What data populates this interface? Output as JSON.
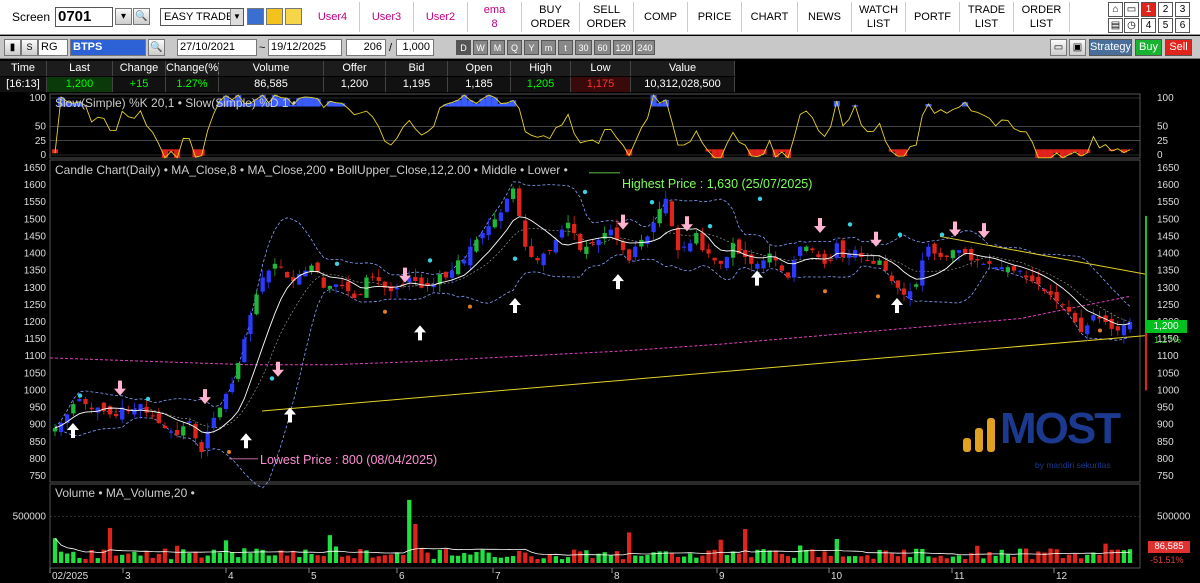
{
  "toolbar": {
    "screen_label": "Screen",
    "screen_code": "0701",
    "mode": "EASY TRADE",
    "menu": [
      {
        "label": "User4",
        "kind": "user"
      },
      {
        "label": "User3",
        "kind": "user"
      },
      {
        "label": "User2",
        "kind": "user"
      },
      {
        "label": "ema\n8",
        "kind": "user"
      },
      {
        "label": "BUY\nORDER",
        "kind": "std"
      },
      {
        "label": "SELL\nORDER",
        "kind": "std"
      },
      {
        "label": "COMP",
        "kind": "std"
      },
      {
        "label": "PRICE",
        "kind": "std"
      },
      {
        "label": "CHART",
        "kind": "std"
      },
      {
        "label": "NEWS",
        "kind": "std"
      },
      {
        "label": "WATCH\nLIST",
        "kind": "std"
      },
      {
        "label": "PORTF",
        "kind": "std"
      },
      {
        "label": "TRADE\nLIST",
        "kind": "std"
      },
      {
        "label": "ORDER\nLIST",
        "kind": "std"
      }
    ],
    "grid_top": [
      "1",
      "2",
      "3"
    ],
    "grid_bot": [
      "4",
      "5",
      "6"
    ]
  },
  "chartbar": {
    "s_label": "S",
    "market": "RG",
    "symbol": "BTPS",
    "date_from": "27/10/2021",
    "date_to": "19/12/2025",
    "count": "206",
    "span": "1,000",
    "timeframes": [
      "D",
      "W",
      "M",
      "Q",
      "Y",
      "m",
      "t",
      "30",
      "60",
      "120",
      "240"
    ],
    "strategy": "Strategy",
    "buy": "Buy",
    "sell": "Sell"
  },
  "quote": {
    "headers": [
      "Time",
      "Last",
      "Change",
      "Change(%)",
      "Volume",
      "Offer",
      "Bid",
      "Open",
      "High",
      "Low",
      "Value"
    ],
    "values": [
      "[16:13]",
      "1,200",
      "+15",
      "1.27%",
      "86,585",
      "1,200",
      "1,195",
      "1,185",
      "1,205",
      "1,175",
      "10,312,028,500"
    ],
    "colors": [
      "#ffffff",
      "#00ff00",
      "#00ff00",
      "#00ff00",
      "#ffffff",
      "#ffffff",
      "#ffffff",
      "#ffffff",
      "#00ff00",
      "#ff3030",
      "#ffffff"
    ]
  },
  "stoch": {
    "title": "Slow(Simple) %K  20,1 • Slow(Simple) %D  1 •",
    "ticks": [
      100,
      50,
      25,
      0
    ]
  },
  "candle": {
    "title": "Candle Chart(Daily) • MA_Close,8 • MA_Close,200 • BollUpper_Close,12,2.00 • Middle • Lower •",
    "highest": "Highest Price : 1,630 (25/07/2025)",
    "lowest": "Lowest Price : 800 (08/04/2025)",
    "last_tag": "1,200",
    "pct_tag": "1.27%",
    "logo": "MOST",
    "logo_sub": "by mandiri sekuritas"
  },
  "volume": {
    "title": "Volume • MA_Volume,20 •",
    "tick": "500000",
    "last_tag": "86,585",
    "pct_tag": "-51.51%"
  },
  "xaxis": {
    "labels": [
      "02/2025",
      "3",
      "4",
      "5",
      "6",
      "7",
      "8",
      "9",
      "10",
      "11",
      "12"
    ]
  },
  "chart_data": {
    "type": "candlestick",
    "title": "Candle Chart(Daily)",
    "series": [
      {
        "name": "MA_Close,8"
      },
      {
        "name": "MA_Close,200"
      },
      {
        "name": "BollUpper_Close,12,2.00"
      },
      {
        "name": "Middle"
      },
      {
        "name": "Lower"
      }
    ],
    "y_ticks": [
      1650,
      1600,
      1550,
      1500,
      1450,
      1400,
      1350,
      1300,
      1250,
      1200,
      1150,
      1100,
      1050,
      1000,
      950,
      900,
      850,
      800,
      750
    ],
    "ylim": [
      750,
      1650
    ],
    "highest": 1630,
    "lowest": 800,
    "last": 1200,
    "volume_y_ticks": [
      500000
    ],
    "stochastic_ticks": [
      0,
      25,
      50,
      100
    ],
    "x_months": [
      "02/2025",
      "3",
      "4",
      "5",
      "6",
      "7",
      "8",
      "9",
      "10",
      "11",
      "12"
    ],
    "close_path": [
      890,
      905,
      930,
      960,
      975,
      960,
      945,
      950,
      940,
      930,
      925,
      950,
      940,
      945,
      960,
      935,
      925,
      905,
      890,
      880,
      870,
      895,
      910,
      860,
      820,
      880,
      920,
      950,
      990,
      1020,
      1080,
      1150,
      1220,
      1280,
      1330,
      1350,
      1370,
      1360,
      1330,
      1320,
      1340,
      1350,
      1365,
      1345,
      1300,
      1305,
      1310,
      1305,
      1290,
      1270,
      1280,
      1330,
      1330,
      1320,
      1300,
      1290,
      1300,
      1310,
      1330,
      1320,
      1300,
      1305,
      1310,
      1340,
      1330,
      1350,
      1380,
      1380,
      1420,
      1440,
      1460,
      1480,
      1500,
      1520,
      1560,
      1590,
      1510,
      1420,
      1390,
      1380,
      1400,
      1410,
      1440,
      1470,
      1490,
      1460,
      1410,
      1420,
      1430,
      1440,
      1460,
      1470,
      1440,
      1410,
      1380,
      1420,
      1440,
      1450,
      1490,
      1530,
      1560,
      1480,
      1410,
      1420,
      1430,
      1460,
      1410,
      1400,
      1380,
      1370,
      1390,
      1430,
      1400,
      1390,
      1370,
      1370,
      1380,
      1400,
      1380,
      1350,
      1330,
      1380,
      1420,
      1420,
      1410,
      1390,
      1370,
      1380,
      1430,
      1390,
      1400,
      1410,
      1390,
      1380,
      1370,
      1380,
      1350,
      1320,
      1300,
      1280,
      1290,
      1310,
      1380,
      1420,
      1400,
      1390,
      1390,
      1410,
      1410,
      1400,
      1380,
      1380,
      1370,
      1370,
      1360,
      1360,
      1360,
      1350,
      1350,
      1330,
      1320,
      1310,
      1290,
      1280,
      1260,
      1250,
      1230,
      1200,
      1170,
      1190,
      1220,
      1210,
      1200,
      1180,
      1175,
      1190,
      1200
    ]
  }
}
